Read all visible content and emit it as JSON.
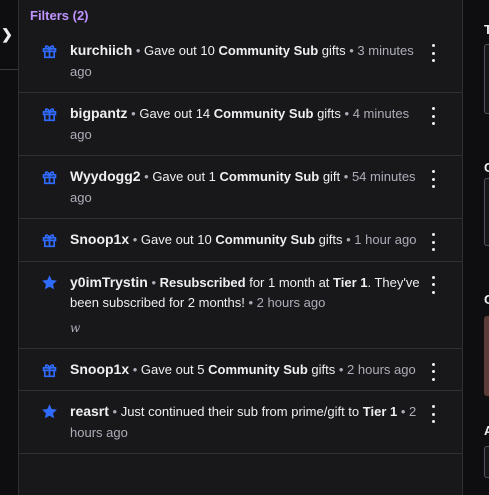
{
  "filters": {
    "label": "Filters (2)"
  },
  "events": [
    {
      "icon": "gift-icon",
      "user": "kurchiich",
      "sep": " • ",
      "pre": "Gave out 10 ",
      "bold": "Community Sub",
      "post": " gifts",
      "sep2": " • ",
      "time": "3 minutes ago"
    },
    {
      "icon": "gift-icon",
      "user": "bigpantz",
      "sep": " • ",
      "pre": "Gave out 14 ",
      "bold": "Community Sub",
      "post": " gifts",
      "sep2": " • ",
      "time": "4 minutes ago"
    },
    {
      "icon": "gift-icon",
      "user": "Wyydogg2",
      "sep": " • ",
      "pre": "Gave out 1 ",
      "bold": "Community Sub",
      "post": " gift",
      "sep2": " • ",
      "time": "54 minutes ago"
    },
    {
      "icon": "gift-icon",
      "user": "Snoop1x",
      "sep": " • ",
      "pre": "Gave out 10 ",
      "bold": "Community Sub",
      "post": " gifts",
      "sep2": " • ",
      "time": "1 hour ago"
    },
    {
      "icon": "star-icon",
      "user": "y0imTrystin",
      "sep": " • ",
      "bold1": "Resubscribed",
      "mid": " for 1 month at ",
      "bold2": "Tier 1",
      "post": ". They've been subscribed for 2 months!",
      "sep2": " • ",
      "time": "2 hours ago",
      "note": "w"
    },
    {
      "icon": "gift-icon",
      "user": "Snoop1x",
      "sep": " • ",
      "pre": "Gave out 5 ",
      "bold": "Community Sub",
      "post": " gifts",
      "sep2": " • ",
      "time": "2 hours ago"
    },
    {
      "icon": "star-icon",
      "user": "reasrt",
      "sep": " • ",
      "pre": "Just continued their sub from prime/gift to ",
      "bold": "Tier 1",
      "sep2": " • ",
      "time": "2 hours ago"
    }
  ],
  "right_panel": {
    "labels": [
      "T",
      "C",
      "C",
      "A"
    ]
  },
  "colors": {
    "accent": "#bf94ff",
    "icon_blue": "#2f6bff"
  }
}
